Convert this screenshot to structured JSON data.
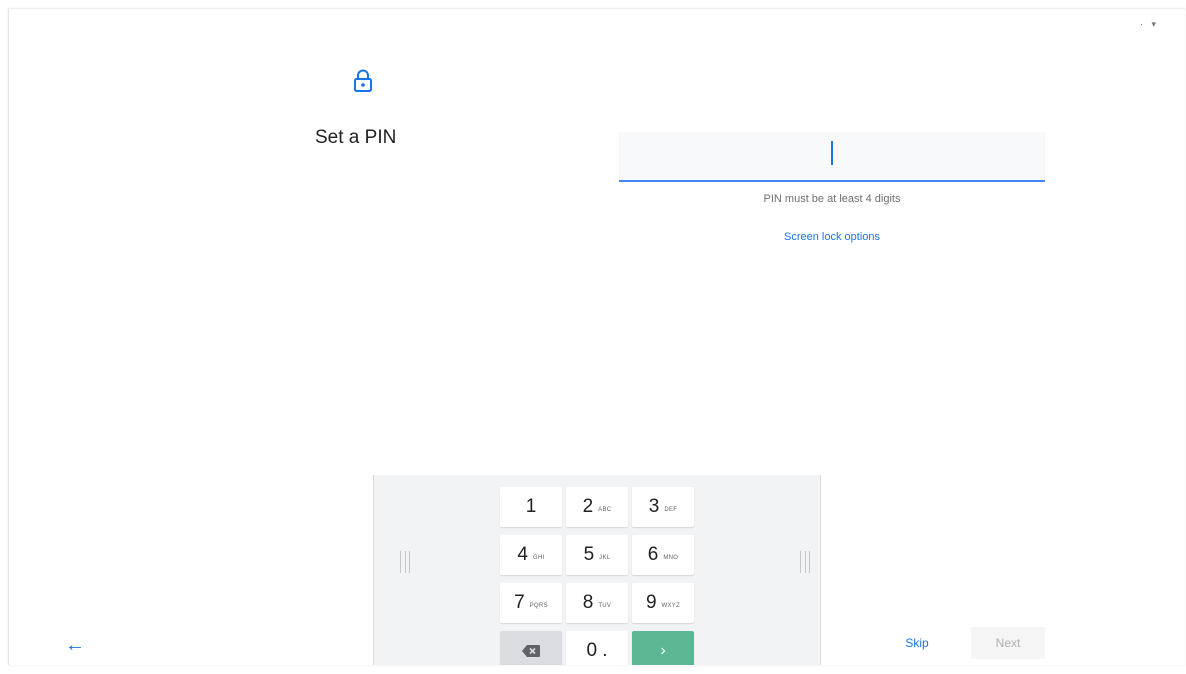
{
  "title": "Set a PIN",
  "pin_field": {
    "value": ""
  },
  "hint": "PIN must be at least 4 digits",
  "screen_lock_options": "Screen lock options",
  "keypad": {
    "keys": [
      {
        "digit": "1",
        "letters": ""
      },
      {
        "digit": "2",
        "letters": "ABC"
      },
      {
        "digit": "3",
        "letters": "DEF"
      },
      {
        "digit": "4",
        "letters": "GHI"
      },
      {
        "digit": "5",
        "letters": "JKL"
      },
      {
        "digit": "6",
        "letters": "MNO"
      },
      {
        "digit": "7",
        "letters": "PQRS"
      },
      {
        "digit": "8",
        "letters": "TUV"
      },
      {
        "digit": "9",
        "letters": "WXYZ"
      }
    ],
    "zero_label": "0 .",
    "backspace_icon": "backspace-icon",
    "go_icon": "chevron-right-icon",
    "go_glyph": "›"
  },
  "nav": {
    "back_glyph": "←",
    "skip": "Skip",
    "next": "Next"
  },
  "colors": {
    "accent": "#1a73e8",
    "field_underline": "#4285f4",
    "go_key": "#5cb894",
    "keyboard_bg": "#f1f3f4"
  }
}
